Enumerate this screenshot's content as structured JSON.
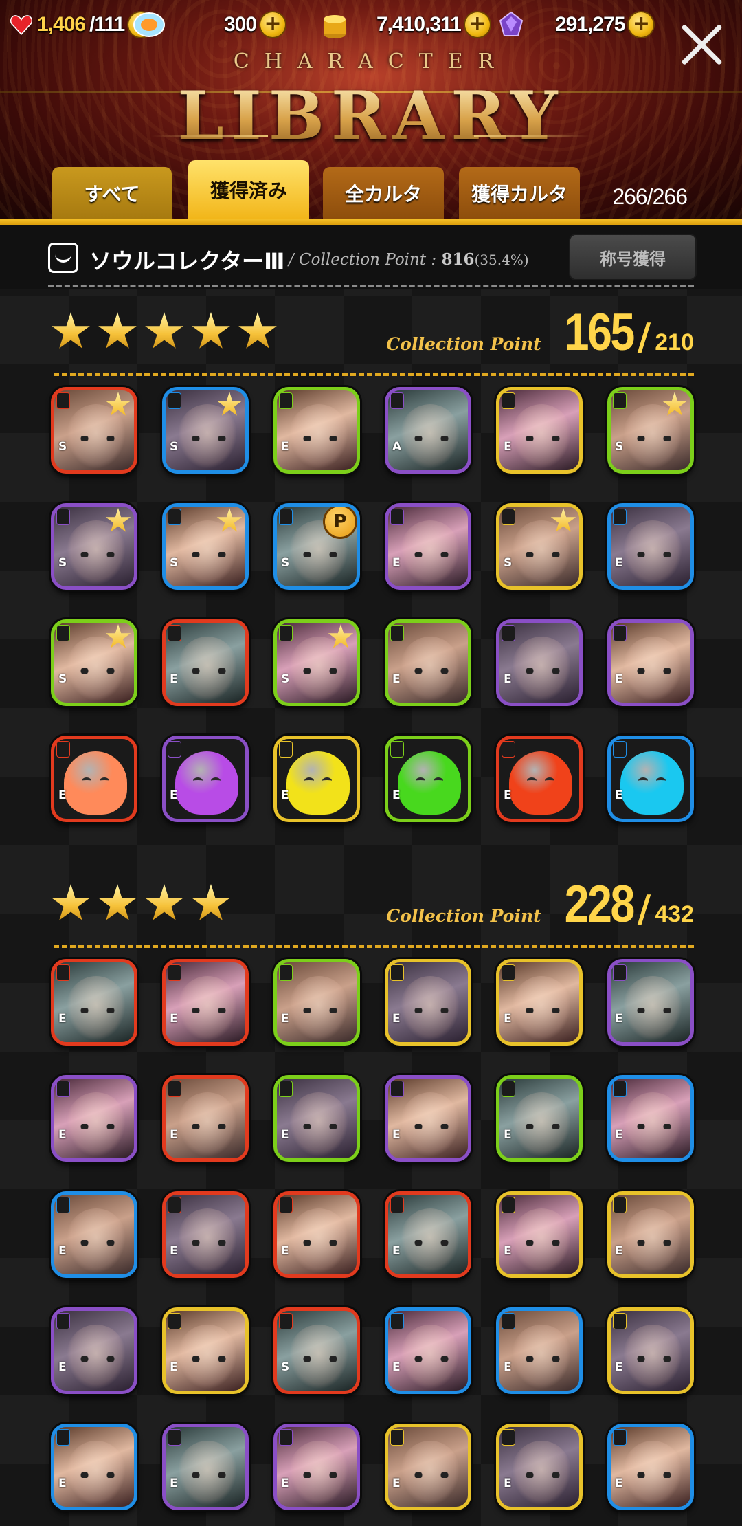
{
  "resources": {
    "stamina": "1,406",
    "stamina_max": "/111",
    "gems": "300",
    "coins": "7,410,311",
    "crystals": "291,275"
  },
  "header": {
    "subtitle": "CHARACTER",
    "title": "LIBRARY"
  },
  "tabs": [
    {
      "label": "すべて",
      "active": false
    },
    {
      "label": "獲得済み",
      "active": true
    },
    {
      "label": "全カルタ",
      "active": false
    },
    {
      "label": "獲得カルタ",
      "active": false
    }
  ],
  "count": "266/266",
  "collector": {
    "name": "ソウルコレクターⅢ",
    "point_label": "/ Collection Point :",
    "point_value": "816",
    "point_pct": "(35.4%)",
    "title_button": "称号獲得"
  },
  "sections": [
    {
      "stars": 5,
      "cp_label": "Collection Point",
      "cp_value": "165",
      "cp_sep": "/",
      "cp_total": "210",
      "tiles": [
        {
          "element": "fire",
          "rank": "S",
          "badge": "star"
        },
        {
          "element": "water",
          "rank": "S",
          "badge": "star"
        },
        {
          "element": "wind",
          "rank": "E",
          "badge": ""
        },
        {
          "element": "dark",
          "rank": "A",
          "badge": ""
        },
        {
          "element": "light",
          "rank": "E",
          "badge": ""
        },
        {
          "element": "wind",
          "rank": "S",
          "badge": "star"
        },
        {
          "element": "dark",
          "rank": "S",
          "badge": "star"
        },
        {
          "element": "water",
          "rank": "S",
          "badge": "star"
        },
        {
          "element": "water",
          "rank": "S",
          "badge": "p"
        },
        {
          "element": "dark",
          "rank": "E",
          "badge": ""
        },
        {
          "element": "light",
          "rank": "S",
          "badge": "star"
        },
        {
          "element": "water",
          "rank": "E",
          "badge": ""
        },
        {
          "element": "wind",
          "rank": "S",
          "badge": "star"
        },
        {
          "element": "fire",
          "rank": "E",
          "badge": ""
        },
        {
          "element": "wind",
          "rank": "S",
          "badge": "star"
        },
        {
          "element": "wind",
          "rank": "E",
          "badge": ""
        },
        {
          "element": "dark",
          "rank": "E",
          "badge": ""
        },
        {
          "element": "dark",
          "rank": "E",
          "badge": ""
        },
        {
          "element": "fire",
          "rank": "E",
          "badge": "",
          "slime": "#ff8a5a"
        },
        {
          "element": "dark",
          "rank": "E",
          "badge": "",
          "slime": "#b84ce6"
        },
        {
          "element": "light",
          "rank": "E",
          "badge": "",
          "slime": "#f2e21a"
        },
        {
          "element": "wind",
          "rank": "E",
          "badge": "",
          "slime": "#48d81e"
        },
        {
          "element": "fire",
          "rank": "E",
          "badge": "",
          "slime": "#f0421a"
        },
        {
          "element": "water",
          "rank": "E",
          "badge": "",
          "slime": "#1ac8f0"
        }
      ]
    },
    {
      "stars": 4,
      "cp_label": "Collection Point",
      "cp_value": "228",
      "cp_sep": "/",
      "cp_total": "432",
      "tiles": [
        {
          "element": "fire",
          "rank": "E",
          "badge": ""
        },
        {
          "element": "fire",
          "rank": "E",
          "badge": ""
        },
        {
          "element": "wind",
          "rank": "E",
          "badge": ""
        },
        {
          "element": "light",
          "rank": "E",
          "badge": ""
        },
        {
          "element": "light",
          "rank": "E",
          "badge": ""
        },
        {
          "element": "dark",
          "rank": "E",
          "badge": ""
        },
        {
          "element": "dark",
          "rank": "E",
          "badge": ""
        },
        {
          "element": "fire",
          "rank": "E",
          "badge": ""
        },
        {
          "element": "wind",
          "rank": "E",
          "badge": ""
        },
        {
          "element": "dark",
          "rank": "E",
          "badge": ""
        },
        {
          "element": "wind",
          "rank": "E",
          "badge": ""
        },
        {
          "element": "water",
          "rank": "E",
          "badge": ""
        },
        {
          "element": "water",
          "rank": "E",
          "badge": ""
        },
        {
          "element": "fire",
          "rank": "E",
          "badge": ""
        },
        {
          "element": "fire",
          "rank": "E",
          "badge": ""
        },
        {
          "element": "fire",
          "rank": "E",
          "badge": ""
        },
        {
          "element": "light",
          "rank": "E",
          "badge": ""
        },
        {
          "element": "light",
          "rank": "E",
          "badge": ""
        },
        {
          "element": "dark",
          "rank": "E",
          "badge": ""
        },
        {
          "element": "light",
          "rank": "E",
          "badge": ""
        },
        {
          "element": "fire",
          "rank": "S",
          "badge": ""
        },
        {
          "element": "water",
          "rank": "E",
          "badge": ""
        },
        {
          "element": "water",
          "rank": "E",
          "badge": ""
        },
        {
          "element": "light",
          "rank": "E",
          "badge": ""
        },
        {
          "element": "water",
          "rank": "E",
          "badge": ""
        },
        {
          "element": "dark",
          "rank": "E",
          "badge": ""
        },
        {
          "element": "dark",
          "rank": "E",
          "badge": ""
        },
        {
          "element": "light",
          "rank": "E",
          "badge": ""
        },
        {
          "element": "light",
          "rank": "E",
          "badge": ""
        },
        {
          "element": "water",
          "rank": "E",
          "badge": ""
        }
      ]
    }
  ],
  "element_colors": {
    "fire": "#e23a1e",
    "water": "#1f8ee6",
    "wind": "#7ccf1a",
    "light": "#e8c22a",
    "dark": "#8a4fc6"
  }
}
